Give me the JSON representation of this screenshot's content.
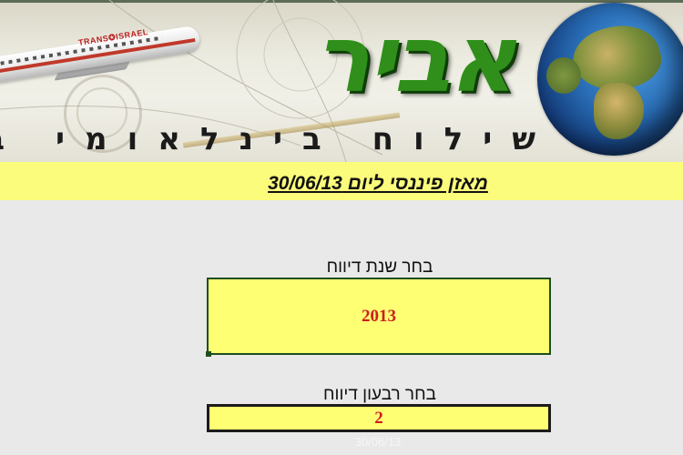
{
  "banner": {
    "logo_text": "אביר",
    "tagline": "שילוח בינלאומי בע",
    "plane_brand": "TRANS✪ISRAEL"
  },
  "report": {
    "title": "מאזן פיננסי ליום 30/06/13"
  },
  "year_selector": {
    "label": "בחר שנת דיווח",
    "value": "2013"
  },
  "quarter_selector": {
    "label": "בחר רבעון דיווח",
    "value": "2"
  },
  "footer": {
    "faint_date": "30/06/13"
  },
  "colors": {
    "title_strip": "#fcfc7c",
    "field_bg": "#ffff73",
    "value_text": "#cc1f1f",
    "logo_green": "#2f8f1a",
    "page_bg": "#e9e9e9"
  }
}
